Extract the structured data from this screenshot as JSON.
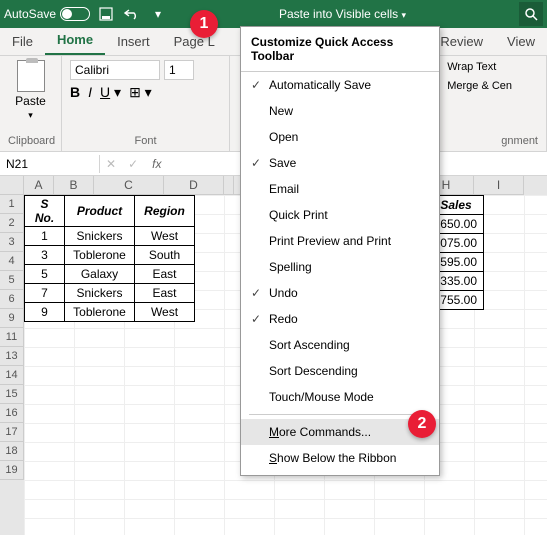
{
  "titlebar": {
    "autosave_label": "AutoSave",
    "center_text": "Paste into Visible cells"
  },
  "tabs": {
    "file": "File",
    "home": "Home",
    "insert": "Insert",
    "pagelayout": "Page L",
    "review": "Review",
    "view": "View"
  },
  "ribbon": {
    "paste_label": "Paste",
    "clipboard_label": "Clipboard",
    "font_name": "Calibri",
    "font_size": "1",
    "font_label": "Font",
    "wrap_label": "Wrap Text",
    "merge_label": "Merge & Cen",
    "alignment_label": "gnment"
  },
  "namebox": {
    "cell": "N21"
  },
  "columns": [
    "",
    "A",
    "B",
    "C",
    "D",
    "",
    "",
    "H",
    "I"
  ],
  "row_numbers": [
    "1",
    "2",
    "3",
    "4",
    "5",
    "6",
    "9",
    "11",
    "13",
    "14",
    "15",
    "16",
    "17",
    "18",
    "19"
  ],
  "table": {
    "headers": {
      "sno": "S No.",
      "product": "Product",
      "region": "Region",
      "sales": "Sales"
    },
    "rows": [
      {
        "sno": "1",
        "product": "Snickers",
        "region": "West",
        "sales": "650.00"
      },
      {
        "sno": "3",
        "product": "Toblerone",
        "region": "South",
        "sales": "075.00"
      },
      {
        "sno": "5",
        "product": "Galaxy",
        "region": "East",
        "sales": "595.00"
      },
      {
        "sno": "7",
        "product": "Snickers",
        "region": "East",
        "sales": "335.00"
      },
      {
        "sno": "9",
        "product": "Toblerone",
        "region": "West",
        "sales": "755.00"
      }
    ]
  },
  "dropdown": {
    "title": "Customize Quick Access Toolbar",
    "items": [
      {
        "label": "Automatically Save",
        "checked": true
      },
      {
        "label": "New",
        "checked": false
      },
      {
        "label": "Open",
        "checked": false
      },
      {
        "label": "Save",
        "checked": true
      },
      {
        "label": "Email",
        "checked": false
      },
      {
        "label": "Quick Print",
        "checked": false
      },
      {
        "label": "Print Preview and Print",
        "checked": false
      },
      {
        "label": "Spelling",
        "checked": false
      },
      {
        "label": "Undo",
        "checked": true
      },
      {
        "label": "Redo",
        "checked": true
      },
      {
        "label": "Sort Ascending",
        "checked": false
      },
      {
        "label": "Sort Descending",
        "checked": false
      },
      {
        "label": "Touch/Mouse Mode",
        "checked": false
      }
    ],
    "more_commands": "More Commands...",
    "show_below": "Show Below the Ribbon"
  },
  "callouts": {
    "one": "1",
    "two": "2"
  }
}
